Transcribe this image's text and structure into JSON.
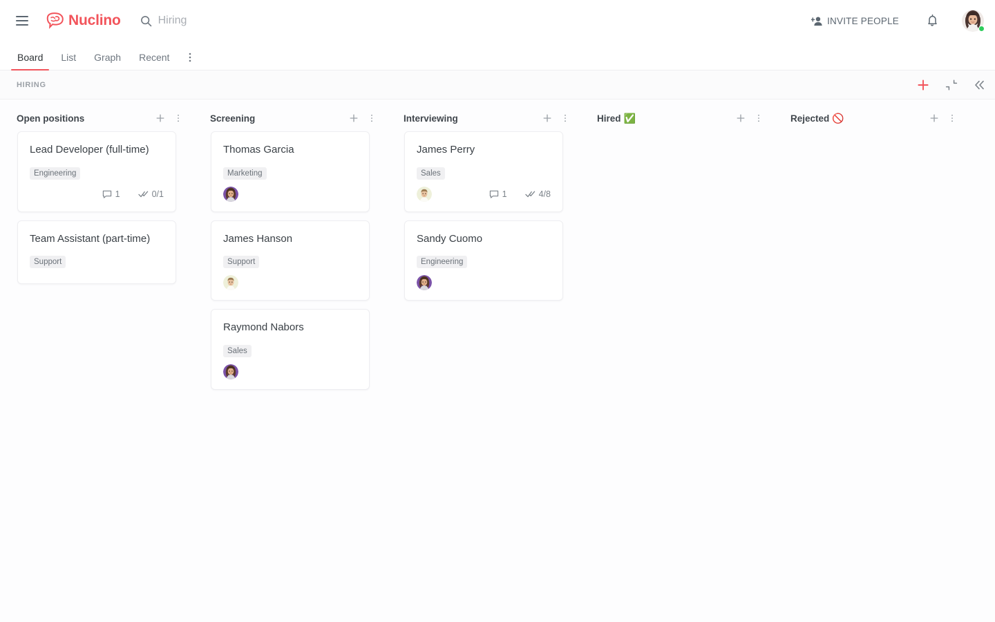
{
  "app": {
    "brand": "Nuclino",
    "logo_icon": "brain-speech-bubble-icon",
    "menu_icon": "hamburger-menu-icon",
    "accent_color": "#f2545b"
  },
  "search": {
    "icon": "search-icon",
    "value": "Hiring",
    "placeholder": "Search"
  },
  "topbar": {
    "invite_label": "INVITE PEOPLE",
    "invite_icon": "person-add-icon",
    "bell_icon": "notification-bell-icon",
    "avatar_icon": "user-avatar",
    "status": "online"
  },
  "tabs": [
    {
      "label": "Board",
      "active": true
    },
    {
      "label": "List",
      "active": false
    },
    {
      "label": "Graph",
      "active": false
    },
    {
      "label": "Recent",
      "active": false
    }
  ],
  "tabs_more_icon": "more-vertical-icon",
  "breadcrumb": "HIRING",
  "board_actions": [
    {
      "name": "add-item-button",
      "icon": "plus-icon",
      "color": "#f2545b"
    },
    {
      "name": "collapse-view-button",
      "icon": "collapse-arrows-icon",
      "color": "#7c838a"
    },
    {
      "name": "collapse-sidebar-button",
      "icon": "chevron-double-left-icon",
      "color": "#7c838a"
    }
  ],
  "columns": [
    {
      "title": "Open positions",
      "emoji": "",
      "add_icon": "plus-icon",
      "more_icon": "more-vertical-icon",
      "cards": [
        {
          "title": "Lead Developer (full-time)",
          "tag": "Engineering",
          "avatar": null,
          "comments": "1",
          "tasks": "0/1",
          "comment_icon": "comment-bubble-icon",
          "task_icon": "double-check-icon"
        },
        {
          "title": "Team Assistant (part-time)",
          "tag": "Support",
          "avatar": null,
          "comments": null,
          "tasks": null,
          "comment_icon": "comment-bubble-icon",
          "task_icon": "double-check-icon"
        }
      ]
    },
    {
      "title": "Screening",
      "emoji": "",
      "add_icon": "plus-icon",
      "more_icon": "more-vertical-icon",
      "cards": [
        {
          "title": "Thomas Garcia",
          "tag": "Marketing",
          "avatar": "purple",
          "comments": null,
          "tasks": null,
          "comment_icon": "comment-bubble-icon",
          "task_icon": "double-check-icon"
        },
        {
          "title": "James Hanson",
          "tag": "Support",
          "avatar": "cream",
          "comments": null,
          "tasks": null,
          "comment_icon": "comment-bubble-icon",
          "task_icon": "double-check-icon"
        },
        {
          "title": "Raymond Nabors",
          "tag": "Sales",
          "avatar": "purple",
          "comments": null,
          "tasks": null,
          "comment_icon": "comment-bubble-icon",
          "task_icon": "double-check-icon"
        }
      ]
    },
    {
      "title": "Interviewing",
      "emoji": "",
      "add_icon": "plus-icon",
      "more_icon": "more-vertical-icon",
      "cards": [
        {
          "title": "James Perry",
          "tag": "Sales",
          "avatar": "cream",
          "comments": "1",
          "tasks": "4/8",
          "comment_icon": "comment-bubble-icon",
          "task_icon": "double-check-icon"
        },
        {
          "title": "Sandy Cuomo",
          "tag": "Engineering",
          "avatar": "purple",
          "comments": null,
          "tasks": null,
          "comment_icon": "comment-bubble-icon",
          "task_icon": "double-check-icon"
        }
      ]
    },
    {
      "title": "Hired",
      "emoji": "✅",
      "add_icon": "plus-icon",
      "more_icon": "more-vertical-icon",
      "cards": []
    },
    {
      "title": "Rejected",
      "emoji": "🚫",
      "add_icon": "plus-icon",
      "more_icon": "more-vertical-icon",
      "cards": []
    }
  ]
}
